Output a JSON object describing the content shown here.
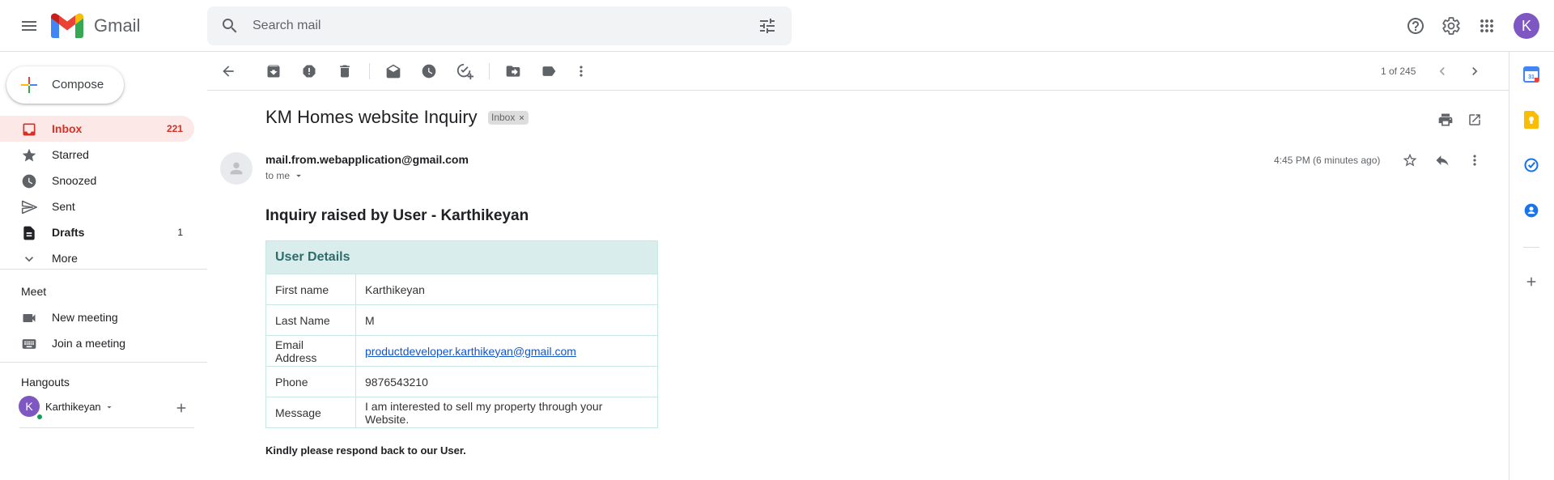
{
  "app": {
    "name": "Gmail"
  },
  "search": {
    "placeholder": "Search mail"
  },
  "user": {
    "avatar_letter": "K"
  },
  "compose": {
    "label": "Compose"
  },
  "sidebar": {
    "items": [
      {
        "label": "Inbox",
        "count": "221"
      },
      {
        "label": "Starred",
        "count": ""
      },
      {
        "label": "Snoozed",
        "count": ""
      },
      {
        "label": "Sent",
        "count": ""
      },
      {
        "label": "Drafts",
        "count": "1"
      },
      {
        "label": "More",
        "count": ""
      }
    ],
    "meet": {
      "title": "Meet",
      "items": [
        {
          "label": "New meeting"
        },
        {
          "label": "Join a meeting"
        }
      ]
    },
    "hangouts": {
      "title": "Hangouts",
      "user": {
        "name": "Karthikeyan",
        "avatar_letter": "K"
      }
    }
  },
  "toolbar": {
    "page_count": "1 of 245"
  },
  "message": {
    "subject": "KM Homes website Inquiry",
    "label_badge": "Inbox",
    "sender": "mail.from.webapplication@gmail.com",
    "to": "to me",
    "timestamp": "4:45 PM (6 minutes ago)",
    "body": {
      "heading": "Inquiry raised by User - Karthikeyan",
      "table_title": "User Details",
      "rows": [
        {
          "key": "First name",
          "value": "Karthikeyan"
        },
        {
          "key": "Last Name",
          "value": "M"
        },
        {
          "key": "Email Address",
          "value": "productdeveloper.karthikeyan@gmail.com"
        },
        {
          "key": "Phone",
          "value": "9876543210"
        },
        {
          "key": "Message",
          "value": "I am interested to sell my property through your Website."
        }
      ],
      "closing": "Kindly please respond back to our User."
    }
  },
  "colors": {
    "accent_red": "#d93025",
    "active_bg": "#fce8e6",
    "avatar_purple": "#7e57c2",
    "table_header_bg": "#d9eded",
    "link": "#1155cc"
  },
  "icons": [
    "menu-icon",
    "gmail-logo-icon",
    "search-icon",
    "tune-icon",
    "help-icon",
    "gear-icon",
    "apps-icon",
    "back-arrow-icon",
    "archive-icon",
    "report-spam-icon",
    "delete-icon",
    "mark-unread-icon",
    "snooze-icon",
    "add-task-icon",
    "move-to-icon",
    "label-icon",
    "more-vert-icon",
    "chevron-left-icon",
    "chevron-right-icon",
    "print-icon",
    "open-new-window-icon",
    "star-icon",
    "reply-icon",
    "calendar-icon",
    "keep-icon",
    "tasks-icon",
    "contacts-icon",
    "plus-icon"
  ]
}
